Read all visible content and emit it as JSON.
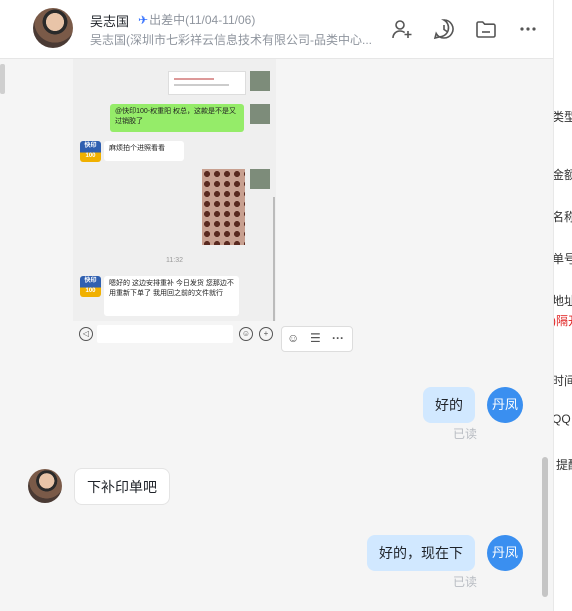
{
  "header": {
    "name": "吴志国",
    "status": "出差中(11/04-11/06)",
    "subtitle": "吴志国(深圳市七彩祥云信息技术有限公司-品类中心..."
  },
  "icons": {
    "add_member": "add-user-icon",
    "history": "chat-history-icon",
    "files": "folder-icon",
    "more": "more-icon"
  },
  "screenshot": {
    "green_text": "@快印100-权重阳 权总，这款是不是又过销胶了",
    "logo_text": "快印100",
    "msg1": "麻烦拍个进照看看",
    "time": "11:32",
    "msg2": "嗯好的  这边安排重补 今日发货 您那边不用重新下单了  我用回之前的文件就行"
  },
  "messages": [
    {
      "from": "me",
      "text": "好的",
      "avatar": "丹凤",
      "read": "已读"
    },
    {
      "from": "other",
      "text": "下补印单吧"
    },
    {
      "from": "me",
      "text": "好的，现在下",
      "avatar": "丹凤",
      "read": "已读"
    }
  ],
  "right_panel": [
    "类型",
    "金额",
    "名称",
    "单号",
    "地址",
    ")隔开",
    "时间",
    "QQ",
    "提醒"
  ],
  "colors": {
    "accent": "#3370ff",
    "my_bubble": "#d1e8ff",
    "avatar_blue": "#3a8ff0"
  }
}
